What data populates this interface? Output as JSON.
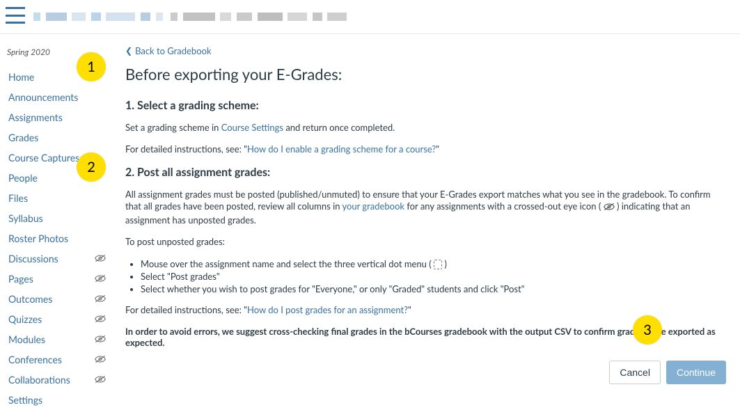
{
  "topbar": {
    "menu_label": "menu"
  },
  "sidebar": {
    "term": "Spring 2020",
    "items": [
      {
        "label": "Home",
        "hidden": false
      },
      {
        "label": "Announcements",
        "hidden": false
      },
      {
        "label": "Assignments",
        "hidden": false
      },
      {
        "label": "Grades",
        "hidden": false
      },
      {
        "label": "Course Captures",
        "hidden": false
      },
      {
        "label": "People",
        "hidden": false
      },
      {
        "label": "Files",
        "hidden": false
      },
      {
        "label": "Syllabus",
        "hidden": false
      },
      {
        "label": "Roster Photos",
        "hidden": false
      },
      {
        "label": "Discussions",
        "hidden": true
      },
      {
        "label": "Pages",
        "hidden": true
      },
      {
        "label": "Outcomes",
        "hidden": true
      },
      {
        "label": "Quizzes",
        "hidden": true
      },
      {
        "label": "Modules",
        "hidden": true
      },
      {
        "label": "Conferences",
        "hidden": true
      },
      {
        "label": "Collaborations",
        "hidden": true
      },
      {
        "label": "Settings",
        "hidden": false
      }
    ]
  },
  "main": {
    "back_label": "Back to Gradebook",
    "title": "Before exporting your E-Grades:",
    "section1": {
      "heading": "1. Select a grading scheme:",
      "p1_pre": "Set a grading scheme in ",
      "p1_link": "Course Settings",
      "p1_post": " and return once completed.",
      "p2_pre": "For detailed instructions, see: \"",
      "p2_link": "How do I enable a grading scheme for a course?",
      "p2_post": "\""
    },
    "section2": {
      "heading": "2. Post all assignment grades:",
      "p1_pre": "All assignment grades must be posted (published/unmuted) to ensure that your E-Grades export matches what you see in the gradebook. To confirm that all grades have been posted, review all columns in ",
      "p1_link": "your gradebook",
      "p1_post": " for any assignments with a crossed-out eye icon ( ",
      "p1_tail": " ) indicating that an assignment has unposted grades.",
      "p2": "To post unposted grades:",
      "bullets": {
        "b1_pre": "Mouse over the assignment name and select the three vertical dot menu ( ",
        "b1_post": " )",
        "b2": "Select \"Post grades\"",
        "b3": "Select whether you wish to post grades for \"Everyone,\" or only \"Graded\" students and click \"Post\""
      },
      "p3_pre": "For detailed instructions, see: \"",
      "p3_link": "How do I post grades for an assignment?",
      "p3_post": "\"",
      "note": "In order to avoid errors, we suggest cross-checking final grades in the bCourses gradebook with the output CSV to confirm grades were exported as expected."
    },
    "actions": {
      "cancel": "Cancel",
      "continue": "Continue"
    }
  },
  "annotations": {
    "a1": "1",
    "a2": "2",
    "a3": "3"
  }
}
